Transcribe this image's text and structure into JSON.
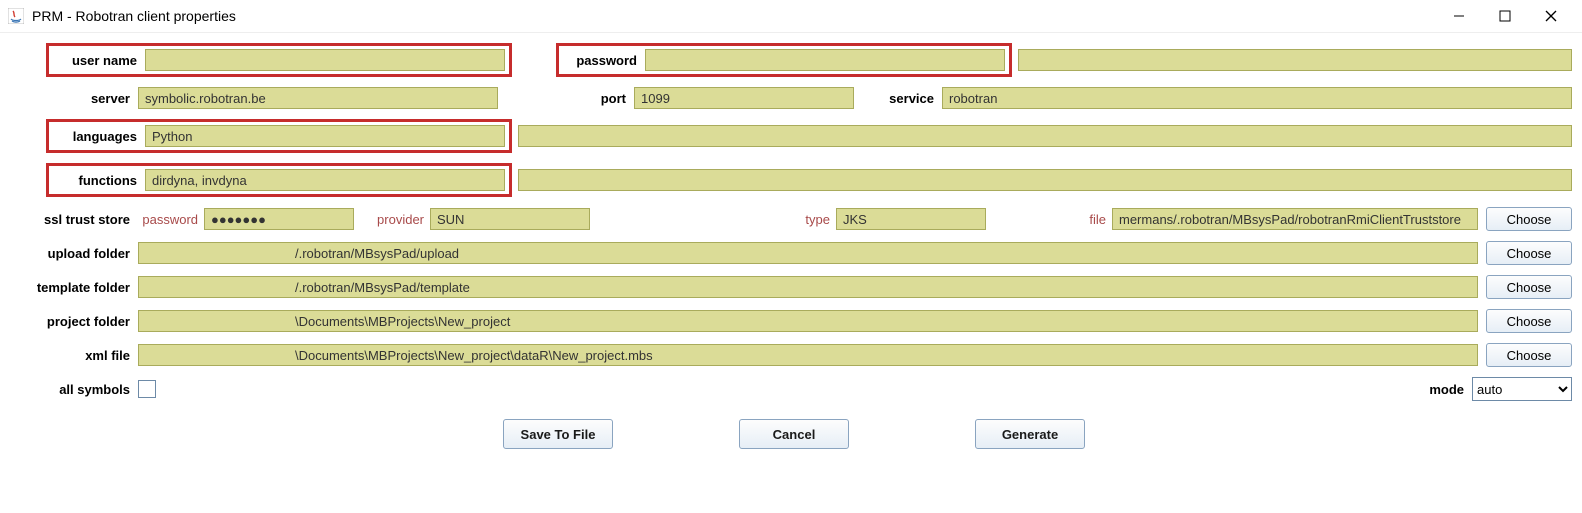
{
  "window": {
    "title": "PRM - Robotran    client properties"
  },
  "labels": {
    "user_name": "user name",
    "password": "password",
    "server": "server",
    "port": "port",
    "service": "service",
    "languages": "languages",
    "functions": "functions",
    "ssl_trust_store": "ssl trust store",
    "ssl_password": "password",
    "ssl_provider": "provider",
    "ssl_type": "type",
    "ssl_file": "file",
    "upload_folder": "upload folder",
    "template_folder": "template folder",
    "project_folder": "project folder",
    "xml_file": "xml file",
    "all_symbols": "all symbols",
    "mode": "mode"
  },
  "values": {
    "user_name": "",
    "password": "",
    "server": "symbolic.robotran.be",
    "port": "1099",
    "service": "robotran",
    "languages": "Python",
    "functions": "dirdyna, invdyna",
    "ssl_password": "●●●●●●●",
    "ssl_provider": "SUN",
    "ssl_type": "JKS",
    "ssl_file": "mermans/.robotran/MBsysPad/robotranRmiClientTruststore",
    "upload_folder": "/.robotran/MBsysPad/upload",
    "template_folder": "/.robotran/MBsysPad/template",
    "project_folder": "\\Documents\\MBProjects\\New_project",
    "xml_file": "\\Documents\\MBProjects\\New_project\\dataR\\New_project.mbs",
    "mode_selected": "auto"
  },
  "buttons": {
    "choose": "Choose",
    "save": "Save To File",
    "cancel": "Cancel",
    "generate": "Generate"
  },
  "options": {
    "mode": [
      "auto"
    ]
  }
}
